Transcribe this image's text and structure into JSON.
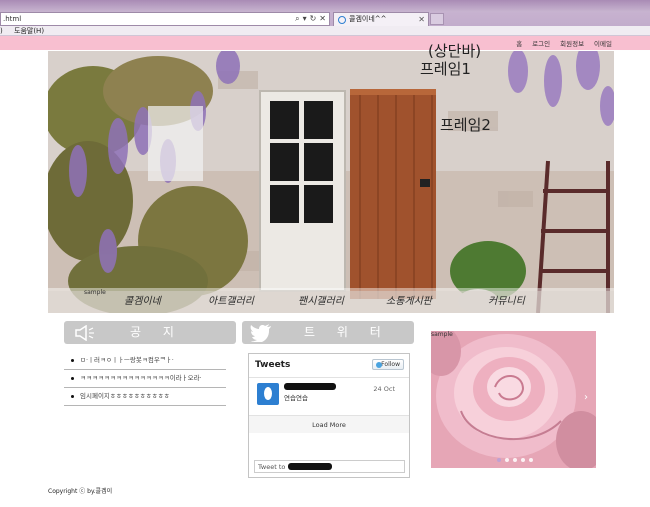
{
  "browser": {
    "address": ".html",
    "tab_title": "콜겜이네^^",
    "menu": [
      "도움말(H)"
    ]
  },
  "topbar": {
    "nav": [
      "홈",
      "로그인",
      "회원정보",
      "이메일"
    ]
  },
  "notes": {
    "top": "(상단바)",
    "frame1": "프레임1",
    "frame2": "프레임2"
  },
  "sample_labels": {
    "hero": "sample",
    "rose": "sample"
  },
  "main_nav": [
    "콜겜이네",
    "아트갤러리",
    "팬시갤러리",
    "소통게시판",
    "커뮤니티"
  ],
  "notice": {
    "title": "공 지",
    "items": [
      "ㅁ·ㅣ러ㅋㅇㅣㅏㅡ랑봇ㅋ컴우ᄏㅏ·",
      "ㅋㅋㅋㅋㅋㅋㅋㅋㅋㅋㅋㅋㅋㅋㅋ이라ㅏ오라·",
      "임시페이지ㅎㅎㅎㅎㅎㅎㅎㅎㅎㅎ"
    ]
  },
  "twitter": {
    "title": "트 위 터",
    "widget_title": "Tweets",
    "follow_label": "Follow",
    "tweet_text": "연습연습",
    "tweet_date": "24 Oct",
    "load_more": "Load More",
    "tweet_to": "Tweet to"
  },
  "footer": {
    "copyright": "Copyright ⓒ by.콜겜이"
  },
  "colors": {
    "topbar": "#f8bfd0",
    "header_bar": "#c8c8c8",
    "twitter_blue": "#4aa3df"
  }
}
